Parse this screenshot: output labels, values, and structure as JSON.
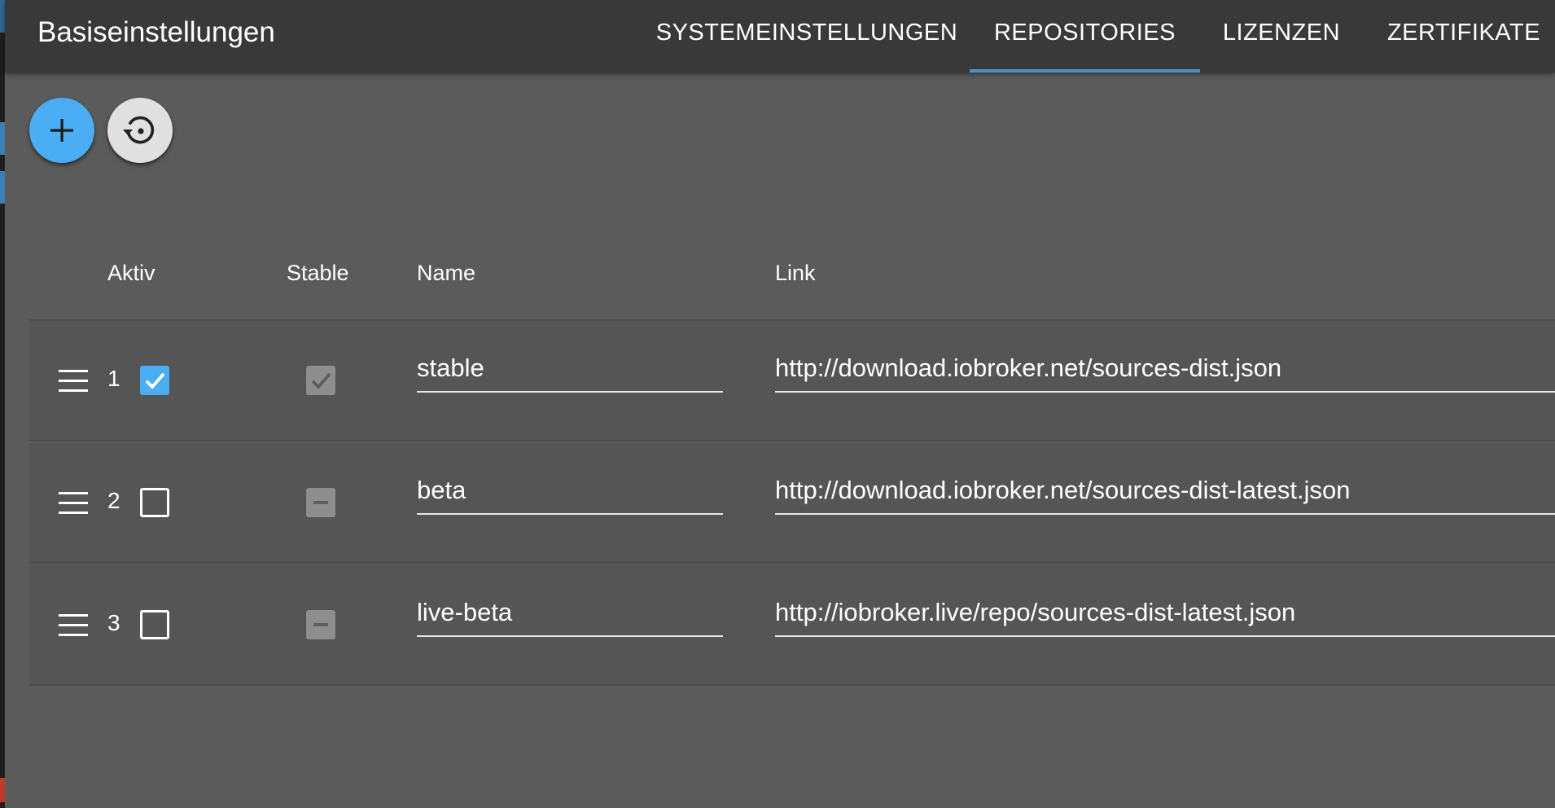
{
  "appbar": {
    "title": "Basiseinstellungen",
    "tabs": [
      {
        "label": "SYSTEMEINSTELLUNGEN",
        "active": false
      },
      {
        "label": "REPOSITORIES",
        "active": true
      },
      {
        "label": "LIZENZEN",
        "active": false
      },
      {
        "label": "ZERTIFIKATE",
        "active": false
      }
    ]
  },
  "actions": {
    "add_icon": "plus-icon",
    "restore_icon": "restore-icon"
  },
  "table": {
    "columns": [
      "Aktiv",
      "Stable",
      "Name",
      "Link"
    ],
    "rows": [
      {
        "num": "1",
        "active": true,
        "stable": "checked",
        "name": "stable",
        "link": "http://download.iobroker.net/sources-dist.json"
      },
      {
        "num": "2",
        "active": false,
        "stable": "indeterminate",
        "name": "beta",
        "link": "http://download.iobroker.net/sources-dist-latest.json"
      },
      {
        "num": "3",
        "active": false,
        "stable": "indeterminate",
        "name": "live-beta",
        "link": "http://iobroker.live/repo/sources-dist-latest.json"
      }
    ]
  },
  "colors": {
    "accent": "#4badf3",
    "appbar": "#393939",
    "background": "#5b5b5b",
    "tab_indicator": "#4a90c9"
  }
}
